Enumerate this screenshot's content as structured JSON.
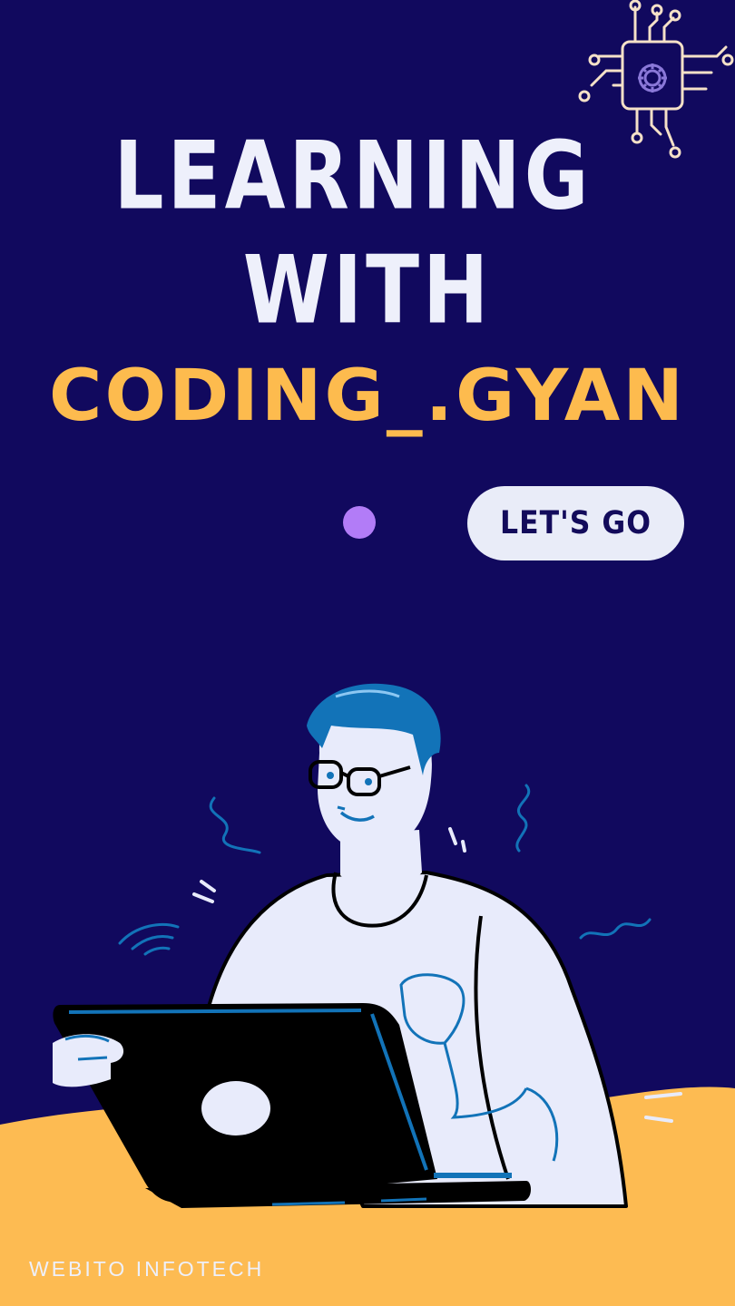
{
  "headline": {
    "line1": "LEARNING",
    "line2": "WITH",
    "brand": "CODING_.GYAN"
  },
  "cta": {
    "label": "LET'S GO"
  },
  "footer": {
    "company": "WEBITO INFOTECH"
  },
  "icons": {
    "chip": "circuit-chip-icon",
    "gear": "gear-icon",
    "dot": "purple-dot"
  },
  "colors": {
    "background": "#11095e",
    "headline": "#eef0fb",
    "brand": "#fdbb4e",
    "accent_dot": "#b27cf7",
    "cta_bg": "#e9ecf8",
    "cta_text": "#130b5b",
    "desk": "#fdbb52",
    "hair": "#1273b8",
    "shirt": "#e8ebfb",
    "chip_line": "#f5e1c8",
    "gear": "#8a78d8"
  }
}
